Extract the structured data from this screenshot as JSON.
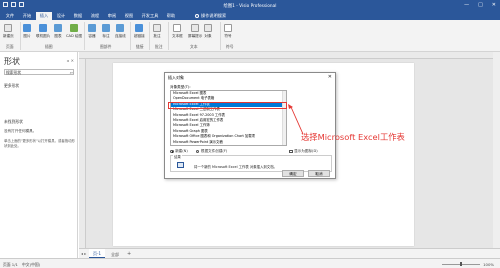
{
  "app": {
    "title": "绘图1 - Visio Professional",
    "window_controls": [
      "—",
      "□",
      "✕"
    ]
  },
  "tabs": [
    {
      "label": "文件"
    },
    {
      "label": "开始"
    },
    {
      "label": "插入"
    },
    {
      "label": "设计"
    },
    {
      "label": "数据"
    },
    {
      "label": "流程"
    },
    {
      "label": "审阅"
    },
    {
      "label": "视图"
    },
    {
      "label": "开发工具"
    },
    {
      "label": "帮助"
    }
  ],
  "tell_me": "操作说明搜索",
  "ribbon": {
    "buttons": [
      {
        "label": "新建页",
        "icon": "new-page-icon",
        "color": "#e8e8e8"
      },
      {
        "label": "图片",
        "icon": "picture-icon",
        "color": "#4a90d9"
      },
      {
        "label": "联机图片",
        "icon": "online-picture-icon",
        "color": "#4a90d9"
      },
      {
        "label": "图表",
        "icon": "chart-icon",
        "color": "#5b9bd5"
      },
      {
        "label": "CAD 绘图",
        "icon": "cad-icon",
        "color": "#70ad47"
      },
      {
        "label": "容器",
        "icon": "container-icon",
        "color": "#5b9bd5"
      },
      {
        "label": "标注",
        "icon": "callout-icon",
        "color": "#5b9bd5"
      },
      {
        "label": "连接线",
        "icon": "connector-icon",
        "color": "#5b9bd5"
      },
      {
        "label": "超链接",
        "icon": "hyperlink-icon",
        "color": "#4a90d9"
      },
      {
        "label": "批注",
        "icon": "comment-icon",
        "color": "#e8e8e8"
      },
      {
        "label": "文本框",
        "icon": "textbox-icon",
        "color": "#ffffff"
      },
      {
        "label": "屏幕提示",
        "icon": "screentip-icon",
        "color": "#e8e8e8"
      },
      {
        "label": "对象",
        "icon": "object-icon",
        "color": "#e8e8e8"
      },
      {
        "label": "符号",
        "icon": "symbol-icon",
        "color": "#ffffff"
      }
    ],
    "groups": [
      "页面",
      "插图",
      "图部件",
      "链接",
      "批注",
      "文本",
      "符号"
    ]
  },
  "shapes_pane": {
    "title": "形状",
    "search_placeholder": "搜索形状",
    "more_shapes": "更多形状",
    "hint_title": "未找到形状",
    "hint_line1": "没有打开任何模具。",
    "hint_line2": "单击上面的\"更多形状\"以打开模具，或者拖动形状到此处。"
  },
  "dialog": {
    "title": "插入对象",
    "object_type_label": "对象类型(T):",
    "items": [
      "Microsoft Excel 图表",
      "OpenDocument 电子表格",
      "Microsoft Excel 工作表",
      "Microsoft Excel 二进制工作表",
      "Microsoft Excel 97-2003 工作表",
      "Microsoft Excel 启用宏的工作表",
      "Microsoft Excel 工作簿",
      "Microsoft Graph 图表",
      "Microsoft Office 图表和 Organization Chart 加载项",
      "Microsoft PowerPoint 演示文稿"
    ],
    "selected_index": 2,
    "show_as_icon": "显示为图标(D)",
    "radio_new": "新建(N)",
    "radio_from_file": "根据文件创建(F)",
    "result_label": "结果",
    "result_text": "将一个新的 Microsoft Excel 工作表 对象插入到文档。",
    "ok": "确定",
    "cancel": "取消"
  },
  "annotation": "选择Microsoft Excel工作表",
  "annotation_color": "#e53935",
  "sheet": {
    "page_tab": "页-1",
    "all_tab": "全部",
    "add": "+"
  },
  "status": {
    "page": "页面 1/1",
    "language": "中文(中国)",
    "zoom": "100%"
  },
  "accent": "#2b579a"
}
